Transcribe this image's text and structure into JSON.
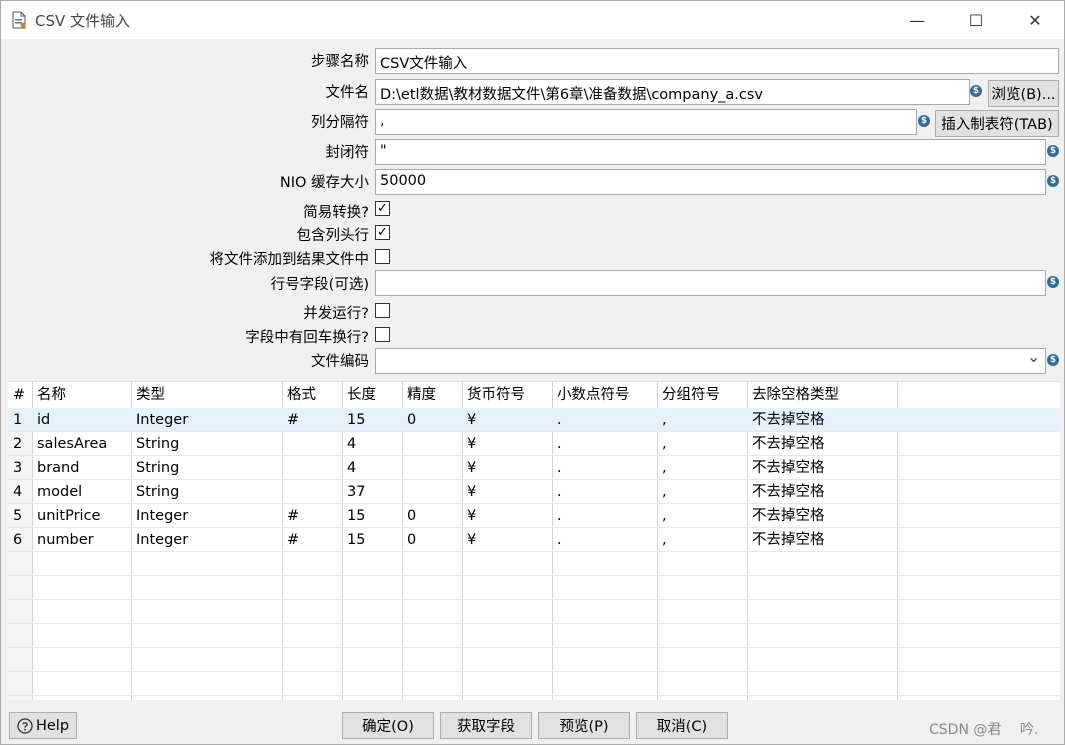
{
  "window": {
    "title": "CSV 文件输入",
    "minimize_glyph": "—",
    "maximize_glyph": "☐",
    "close_glyph": "✕"
  },
  "form": {
    "step_name": {
      "label": "步骤名称",
      "value": "CSV文件输入"
    },
    "file_name": {
      "label": "文件名",
      "value": "D:\\etl数据\\教材数据文件\\第6章\\准备数据\\company_a.csv",
      "browse_label": "浏览(B)..."
    },
    "delimiter": {
      "label": "列分隔符",
      "value": ",",
      "insert_tab_label": "插入制表符(TAB)"
    },
    "enclosure": {
      "label": "封闭符",
      "value": "\""
    },
    "nio_buffer": {
      "label": "NIO 缓存大小",
      "value": "50000"
    },
    "lazy_conversion": {
      "label": "简易转换?",
      "checked": true
    },
    "header_row": {
      "label": "包含列头行",
      "checked": true
    },
    "add_to_result": {
      "label": "将文件添加到结果文件中",
      "checked": false
    },
    "row_num_field": {
      "label": "行号字段(可选)",
      "value": ""
    },
    "parallel": {
      "label": "并发运行?",
      "checked": false
    },
    "newline_in_fields": {
      "label": "字段中有回车换行?",
      "checked": false
    },
    "encoding": {
      "label": "文件编码",
      "value": ""
    },
    "check_glyph": "✓",
    "var_glyph": "$",
    "dropdown_glyph": "⌄"
  },
  "table": {
    "headers": [
      "#",
      "名称",
      "类型",
      "格式",
      "长度",
      "精度",
      "货币符号",
      "小数点符号",
      "分组符号",
      "去除空格类型"
    ],
    "rows": [
      [
        "1",
        "id",
        "Integer",
        "#",
        "15",
        "0",
        "¥",
        ".",
        ",",
        "不去掉空格"
      ],
      [
        "2",
        "salesArea",
        "String",
        "",
        "4",
        "",
        "¥",
        ".",
        ",",
        "不去掉空格"
      ],
      [
        "3",
        "brand",
        "String",
        "",
        "4",
        "",
        "¥",
        ".",
        ",",
        "不去掉空格"
      ],
      [
        "4",
        "model",
        "String",
        "",
        "37",
        "",
        "¥",
        ".",
        ",",
        "不去掉空格"
      ],
      [
        "5",
        "unitPrice",
        "Integer",
        "#",
        "15",
        "0",
        "¥",
        ".",
        ",",
        "不去掉空格"
      ],
      [
        "6",
        "number",
        "Integer",
        "#",
        "15",
        "0",
        "¥",
        ".",
        ",",
        "不去掉空格"
      ]
    ]
  },
  "footer": {
    "help_label": "Help",
    "ok_label": "确定(O)",
    "get_fields_label": "获取字段",
    "preview_label": "预览(P)",
    "cancel_label": "取消(C)",
    "credit": "CSDN @君　 吟."
  }
}
